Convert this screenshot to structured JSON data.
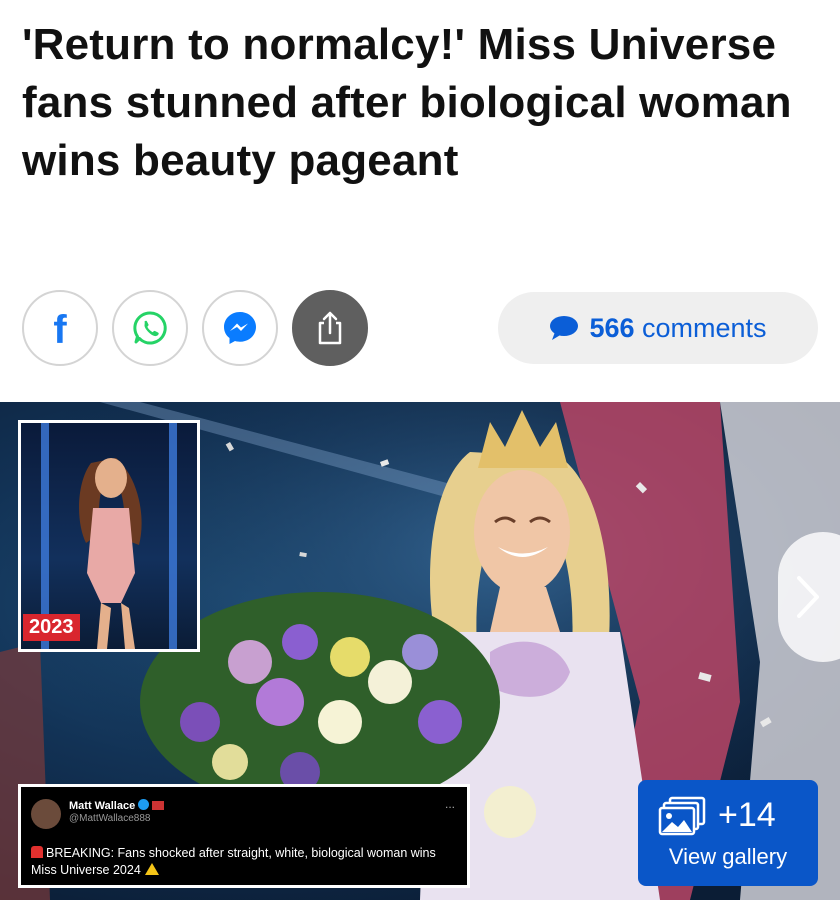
{
  "article": {
    "headline": "'Return to normalcy!' Miss Universe fans stunned after biological woman wins beauty pageant"
  },
  "share": {
    "facebook_glyph": "f",
    "icons": [
      "facebook-icon",
      "whatsapp-icon",
      "messenger-icon",
      "share-icon"
    ]
  },
  "comments": {
    "count": "566",
    "label": "comments"
  },
  "hero": {
    "inset_year": "2023",
    "tweet": {
      "name": "Matt Wallace",
      "handle": "@MattWallace888",
      "more": "...",
      "text": "BREAKING: Fans shocked after straight, white, biological woman wins Miss Universe 2024"
    },
    "gallery": {
      "count": "+14",
      "label": "View gallery"
    }
  },
  "colors": {
    "link_blue": "#0b5ed7",
    "facebook": "#1877f2",
    "gallery_button": "#0a56c8",
    "badge_red": "#d9262e"
  }
}
